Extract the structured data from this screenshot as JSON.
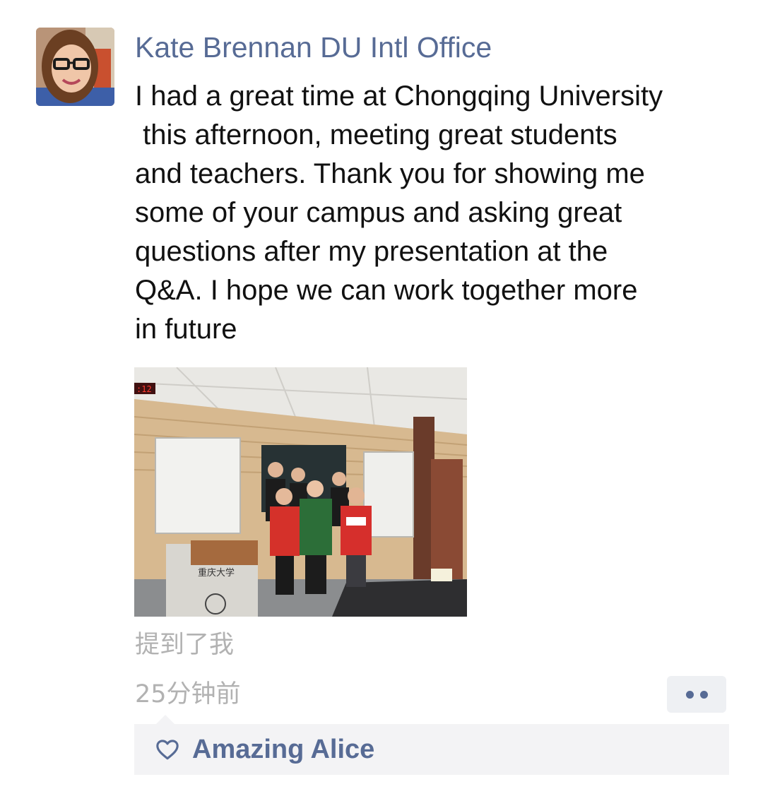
{
  "post": {
    "author": "Kate Brennan DU Intl Office",
    "text_lines": [
      "I had a great time at Chongqing University",
      " this afternoon, meeting great students",
      "and teachers. Thank you for showing me",
      "some of your campus and asking great",
      "questions after my presentation at the",
      "Q&A. I hope we can work together more",
      "in future"
    ],
    "photo": {
      "clock_text": ":12",
      "podium_text": "重庆大学"
    },
    "mention_label": "提到了我",
    "timestamp": "25分钟前",
    "more_icon": "more-dots-icon"
  },
  "likes": {
    "icon": "heart-outline-icon",
    "names": "Amazing Alice"
  },
  "colors": {
    "link_blue": "#576b95",
    "meta_gray": "#b2b2b2",
    "text": "#111111",
    "likes_bg": "#f3f3f5"
  }
}
